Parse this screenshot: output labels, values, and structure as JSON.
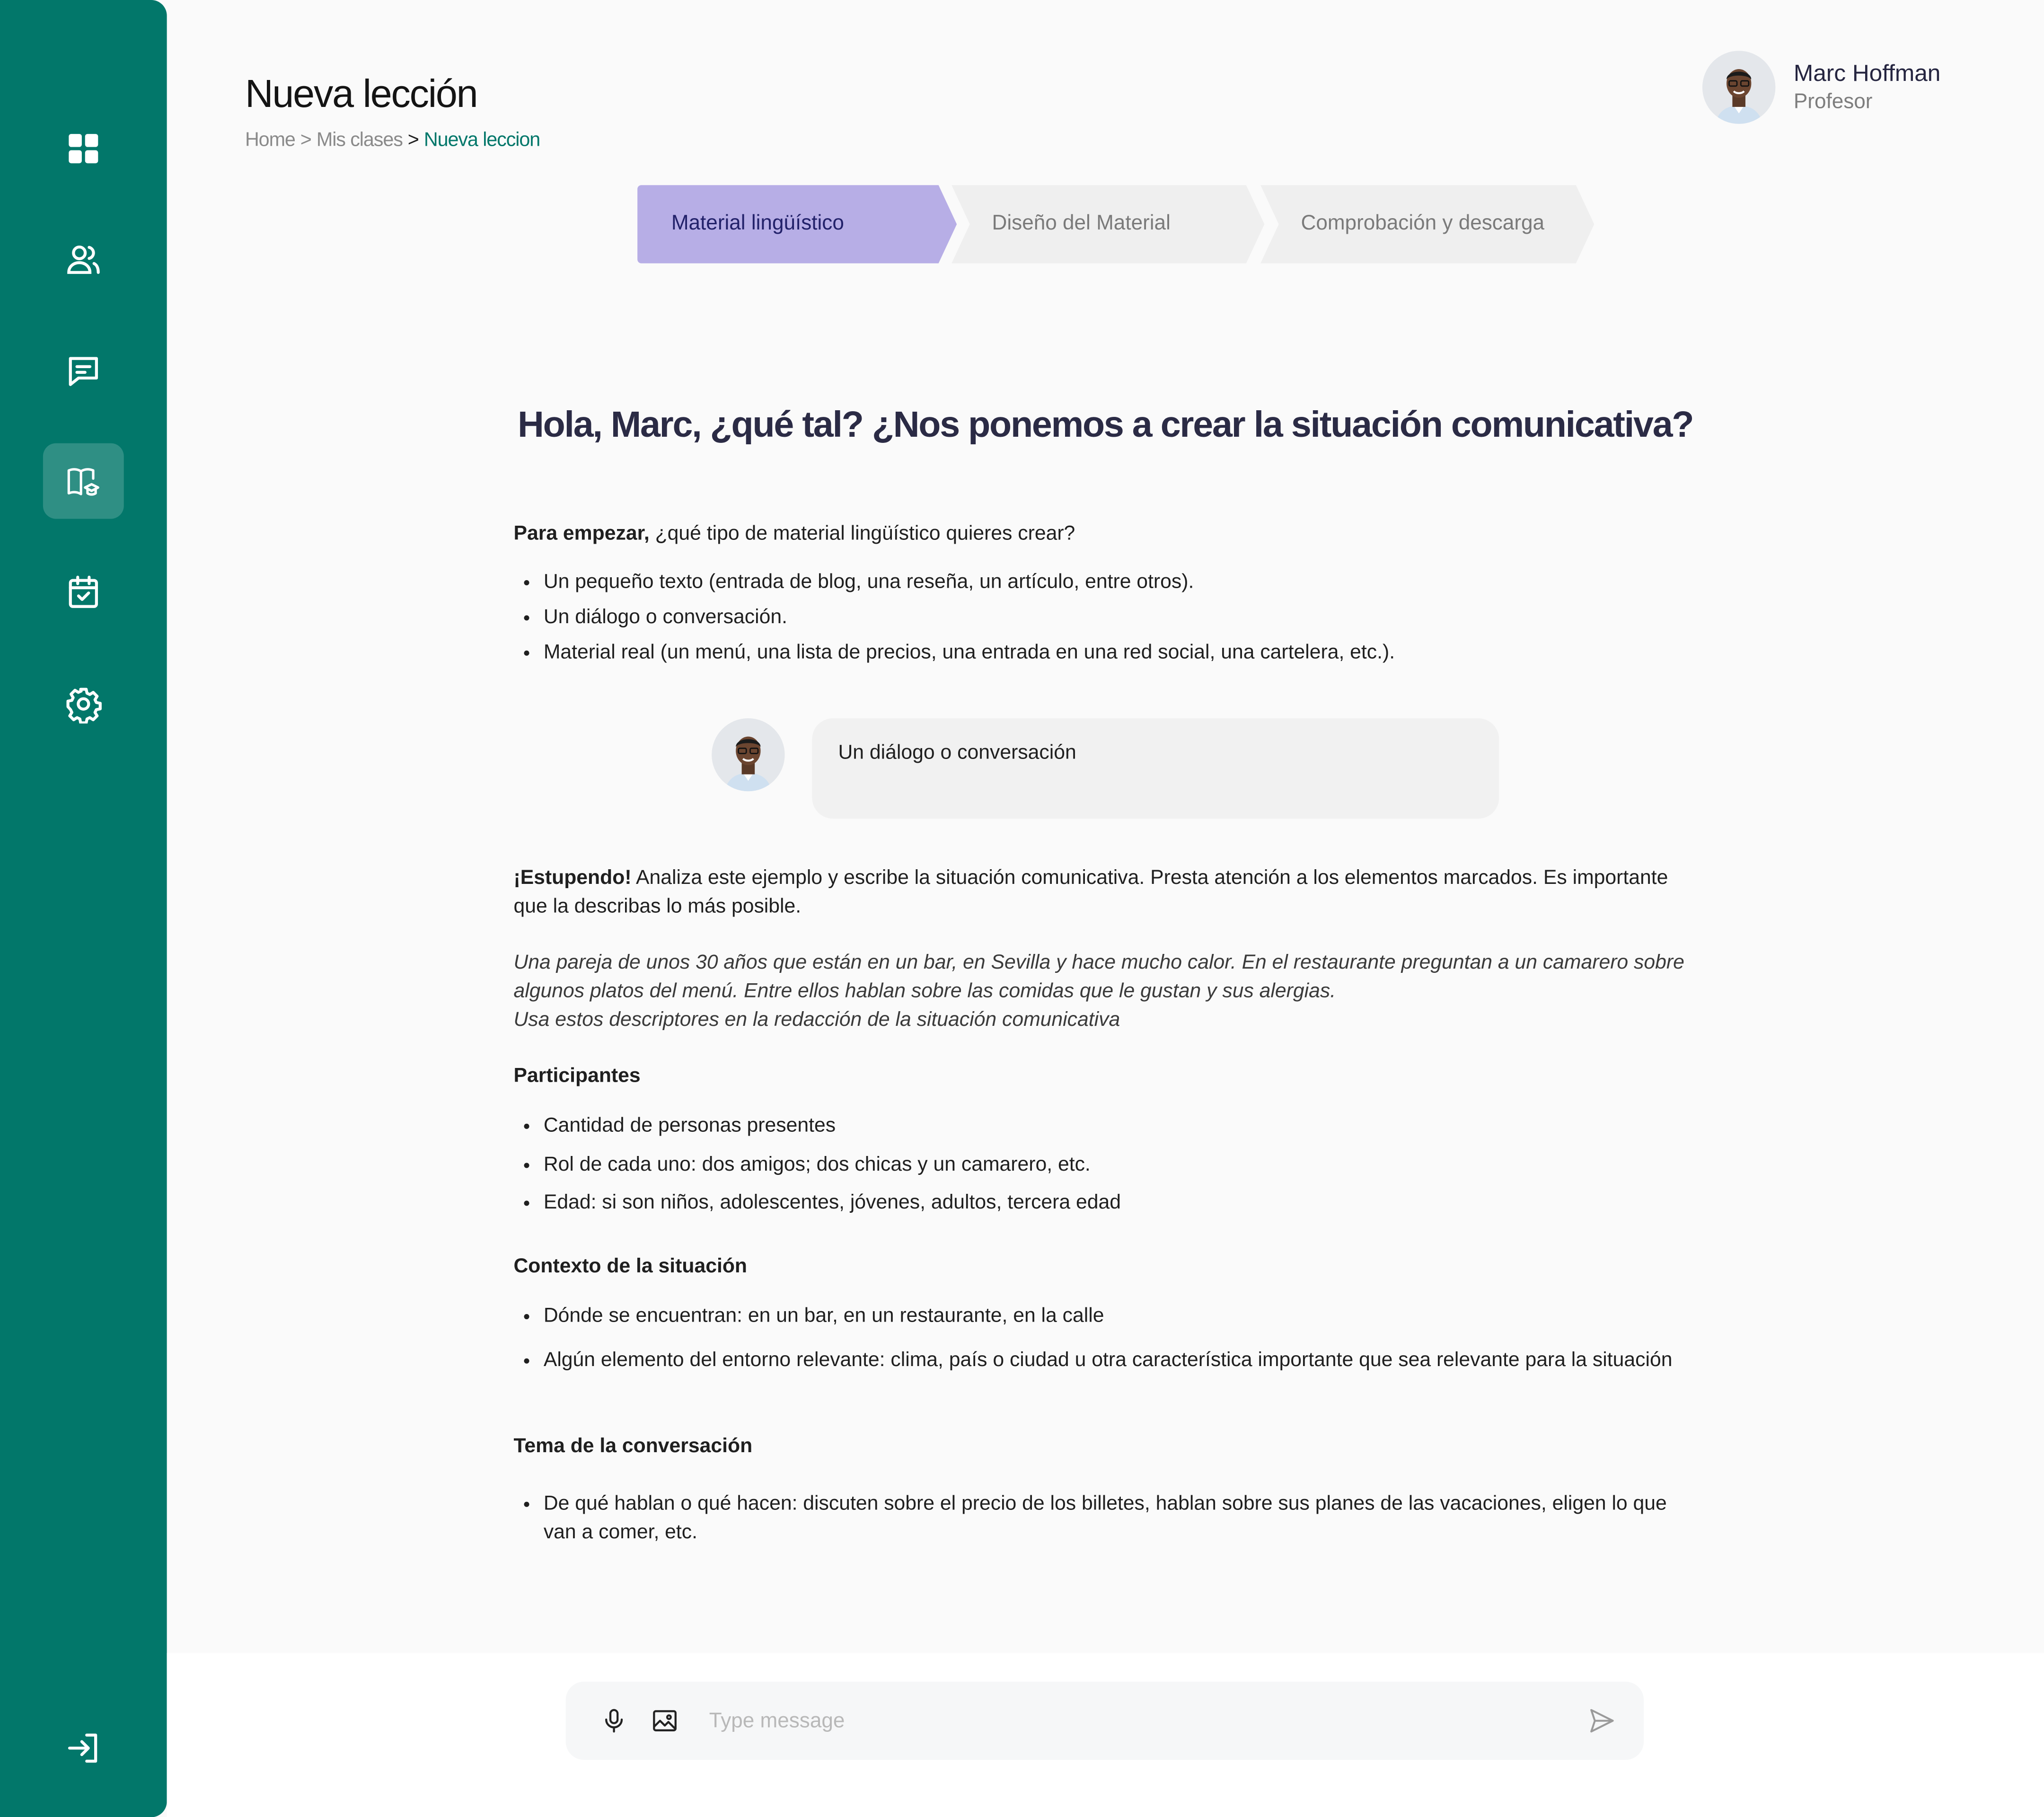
{
  "colors": {
    "sidebar": "#02776a",
    "accent_step": "#b7aee6",
    "inactive_step": "#efefef",
    "breadcrumb_active": "#02776a"
  },
  "sidebar": {
    "items": [
      {
        "icon": "dashboard-icon"
      },
      {
        "icon": "users-icon"
      },
      {
        "icon": "messages-icon"
      },
      {
        "icon": "lessons-book-icon",
        "active": true
      },
      {
        "icon": "calendar-check-icon"
      },
      {
        "icon": "settings-gear-icon"
      }
    ],
    "logout_icon": "logout-icon"
  },
  "header": {
    "title": "Nueva lección",
    "breadcrumb": {
      "home": "Home",
      "sep1": ">",
      "classes": "Mis clases",
      "sep2": ">",
      "current": "Nueva leccion"
    }
  },
  "user": {
    "name": "Marc Hoffman",
    "role": "Profesor"
  },
  "stepper": {
    "steps": [
      {
        "label": "Material lingüístico",
        "active": true
      },
      {
        "label": "Diseño del Material",
        "active": false
      },
      {
        "label": "Comprobación y descarga",
        "active": false
      }
    ]
  },
  "main": {
    "heading": "Hola, Marc, ¿qué tal? ¿Nos ponemos a crear la situación comunicativa?",
    "intro_bold": "Para empezar,",
    "intro_rest": " ¿qué tipo de material lingüístico quieres crear?",
    "options": [
      "Un pequeño texto (entrada de blog, una reseña, un artículo, entre otros).",
      "Un diálogo o conversación.",
      "Material real (un menú, una lista de precios, una entrada en una red social, una cartelera, etc.)."
    ],
    "user_reply": "Un diálogo o conversación",
    "reply_bold": "¡Estupendo!",
    "reply_rest": " Analiza este ejemplo y escribe la situación comunicativa. Presta atención a los elementos marcados. Es importante que la describas lo más posible.",
    "example_line1": "Una pareja de unos 30 años que están en un bar, en Sevilla y hace mucho calor. En el restaurante preguntan a un camarero sobre algunos platos del menú. Entre ellos hablan sobre las comidas que le gustan y sus alergias.",
    "example_line2": "Usa estos descriptores en la redacción de la situación comunicativa",
    "sections": [
      {
        "title": "Participantes",
        "items": [
          "Cantidad de personas presentes",
          "Rol de cada uno: dos amigos; dos chicas y un camarero, etc.",
          "Edad: si son niños, adolescentes, jóvenes, adultos, tercera edad"
        ]
      },
      {
        "title": "Contexto de la situación",
        "items": [
          "Dónde se encuentran: en un bar, en un restaurante, en la calle",
          "Algún elemento del entorno relevante: clima, país o ciudad u otra característica importante que sea relevante para la situación"
        ]
      },
      {
        "title": "Tema de la conversación",
        "items": [
          "De qué hablan o qué hacen: discuten sobre el precio de los billetes, hablan sobre sus planes de las vacaciones, eligen lo que van a comer, etc."
        ]
      }
    ]
  },
  "composer": {
    "placeholder": "Type message",
    "mic_icon": "microphone-icon",
    "image_icon": "image-icon",
    "send_icon": "send-icon"
  }
}
